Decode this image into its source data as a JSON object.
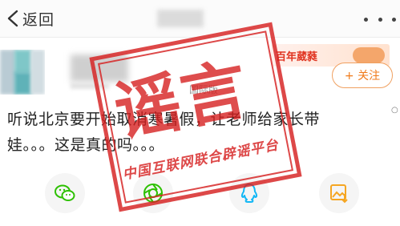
{
  "nav": {
    "back_label": "返回"
  },
  "author": {
    "region_label": "国际版"
  },
  "banner": {
    "text": "百年葳蕤"
  },
  "follow_label": "+ 关注",
  "post": {
    "text": "听说北京要开始取消寒暑假，让老师给家长带娃。。。这是真的吗。。。"
  },
  "stamp": {
    "big": "谣言",
    "small": "中国互联网联合辟谣平台"
  },
  "share": {
    "icons": [
      "wechat-icon",
      "moments-icon",
      "qq-icon",
      "save-image-icon"
    ]
  },
  "colors": {
    "accent": "#f07a1a",
    "stamp": "#d62020",
    "wechat": "#2dc100",
    "qq": "#12b7f5",
    "save": "#f5a623"
  }
}
